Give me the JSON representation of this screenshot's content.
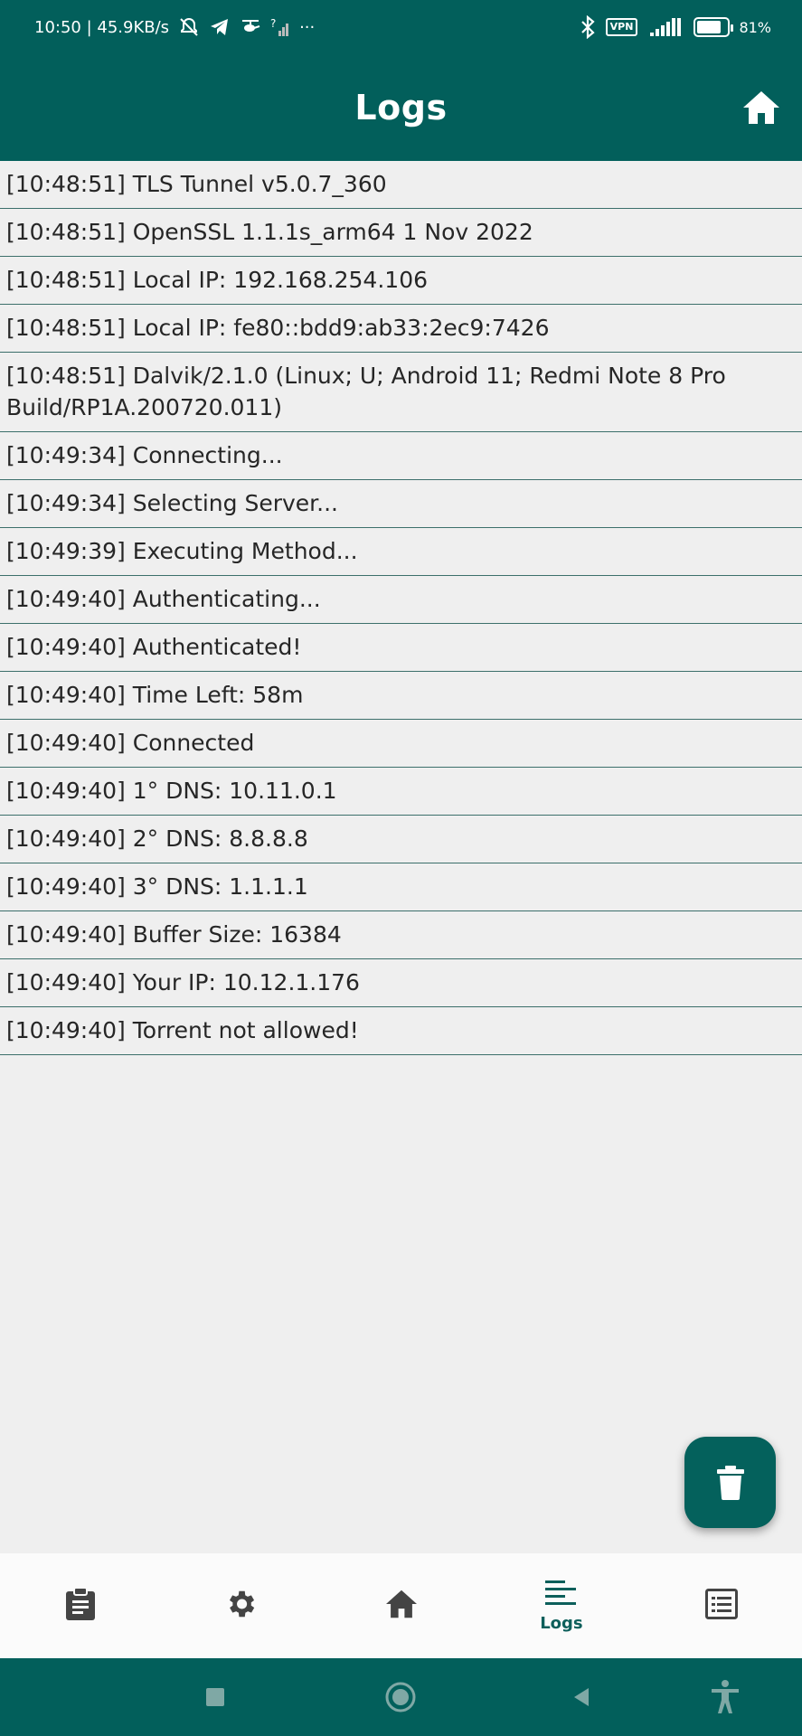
{
  "status_bar": {
    "time_speed": "10:50 | 45.9KB/s",
    "more": "···",
    "vpn": "VPN",
    "battery_percent": "81%",
    "battery_level": 0.81
  },
  "header": {
    "title": "Logs"
  },
  "logs": [
    "[10:48:51] TLS Tunnel v5.0.7_360",
    "[10:48:51] OpenSSL 1.1.1s_arm64 1 Nov 2022",
    "[10:48:51] Local IP: 192.168.254.106",
    "[10:48:51] Local IP: fe80::bdd9:ab33:2ec9:7426",
    "[10:48:51] Dalvik/2.1.0 (Linux; U; Android 11; Redmi Note 8 Pro Build/RP1A.200720.011)",
    "[10:49:34] Connecting...",
    "[10:49:34] Selecting Server...",
    "[10:49:39] Executing Method...",
    "[10:49:40] Authenticating...",
    "[10:49:40] Authenticated!",
    "[10:49:40] Time Left: 58m",
    "[10:49:40] Connected",
    "[10:49:40] 1° DNS: 10.11.0.1",
    "[10:49:40] 2° DNS: 8.8.8.8",
    "[10:49:40] 3° DNS: 1.1.1.1",
    "[10:49:40] Buffer Size: 16384",
    "[10:49:40] Your IP: 10.12.1.176",
    "[10:49:40] Torrent not allowed!"
  ],
  "bottom_nav": {
    "items": [
      {
        "icon": "clipboard-icon",
        "label": ""
      },
      {
        "icon": "gear-icon",
        "label": ""
      },
      {
        "icon": "home-icon",
        "label": ""
      },
      {
        "icon": "logs-icon",
        "label": "Logs"
      },
      {
        "icon": "list-icon",
        "label": ""
      }
    ],
    "active_index": 3
  },
  "colors": {
    "primary": "#025f5b",
    "background": "#efefef",
    "text": "#262626",
    "active_nav": "#0d5f5b",
    "inactive_nav": "#444444"
  }
}
